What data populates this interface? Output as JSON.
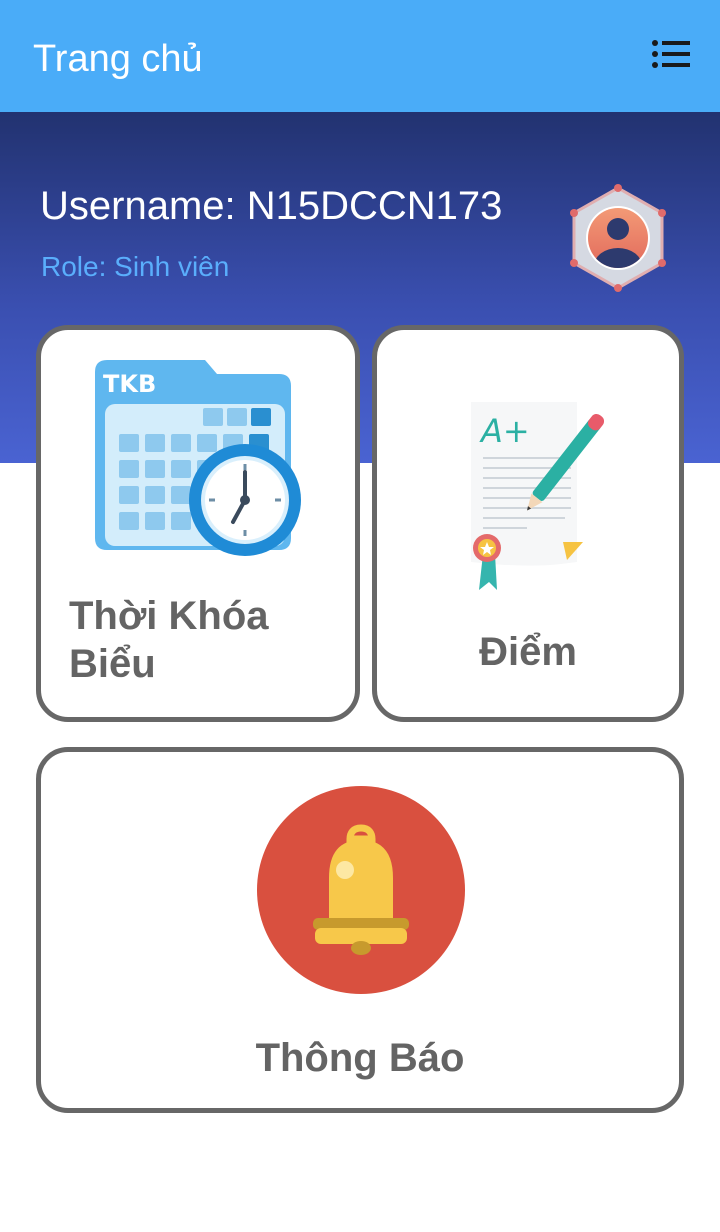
{
  "app_bar": {
    "title": "Trang chủ",
    "menu_icon": "menu-list-icon"
  },
  "profile": {
    "username_text": "Username: N15DCCN173",
    "role_text": "Role: Sinh viên",
    "avatar_icon": "user-avatar-icon"
  },
  "cards": {
    "schedule": {
      "label": "Thời Khóa Biểu",
      "icon": "calendar-clock-icon",
      "icon_text": "TKB"
    },
    "grades": {
      "label": "Điểm",
      "icon": "grade-certificate-icon",
      "icon_text": "A+"
    },
    "notifications": {
      "label": "Thông Báo",
      "icon": "bell-icon"
    }
  },
  "colors": {
    "app_bar": "#4aacf8",
    "hero_top": "#223270",
    "hero_bottom": "#4a63d2",
    "role_text": "#5aaefc",
    "card_border": "#676767",
    "card_label": "#646464",
    "bell_circle": "#d9503f",
    "bell": "#f7c84a"
  }
}
